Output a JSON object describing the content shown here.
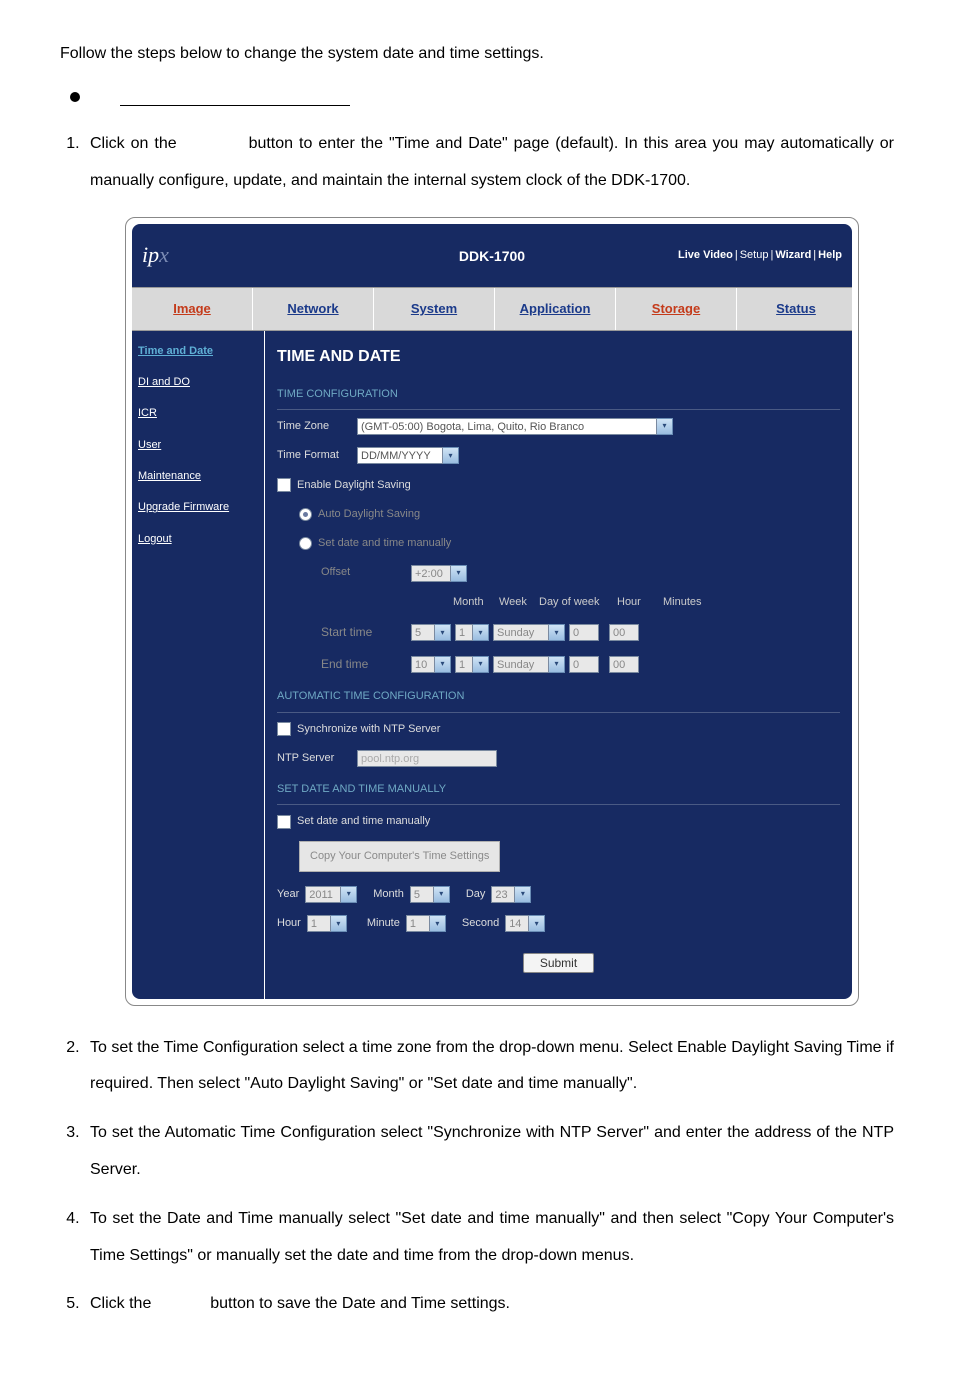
{
  "intro": "Follow the steps below to change the system date and time settings.",
  "steps": {
    "s1a": "Click on the ",
    "s1b": " button to enter the \"Time and Date\" page (default).  In this area you may automatically or manually configure, update, and maintain the internal system clock of the DDK-1700.",
    "s2": "To set the Time Configuration select a time zone from the drop-down menu. Select Enable Daylight Saving Time if required. Then select \"Auto Daylight Saving\" or \"Set date and time manually\".",
    "s3": "To set the Automatic Time Configuration select \"Synchronize with NTP Server\" and enter the address of the NTP Server.",
    "s4": "To set the Date and Time manually select \"Set date and time manually\" and then select \"Copy Your Computer's Time Settings\" or manually set the date and time from the drop-down menus.",
    "s5a": "Click the ",
    "s5b": " button to save the Date and Time settings."
  },
  "ui": {
    "brand1": "ip",
    "brand2": "x",
    "model": "DDK-1700",
    "topLinks": {
      "live": "Live Video",
      "setup": "Setup",
      "wizard": "Wizard",
      "help": "Help"
    },
    "tabs": {
      "image": "Image",
      "network": "Network",
      "system": "System",
      "application": "Application",
      "storage": "Storage",
      "status": "Status"
    },
    "sidebar": {
      "timeAndDate": "Time and Date",
      "diDo": "DI and DO",
      "icr": "ICR",
      "user": "User",
      "maintenance": "Maintenance",
      "upgrade": "Upgrade Firmware",
      "logout": "Logout"
    },
    "content": {
      "title": "TIME AND DATE",
      "sec1": "TIME CONFIGURATION",
      "timeZoneLabel": "Time Zone",
      "timeZoneValue": "(GMT-05:00) Bogota, Lima, Quito, Rio Branco",
      "timeFormatLabel": "Time Format",
      "timeFormatValue": "DD/MM/YYYY",
      "enableDST": "Enable Daylight Saving",
      "autoDST": "Auto Daylight Saving",
      "manualDST": "Set date and time manually",
      "offsetLabel": "Offset",
      "offsetValue": "+2:00",
      "colMonth": "Month",
      "colWeek": "Week",
      "colDow": "Day of week",
      "colHour": "Hour",
      "colMin": "Minutes",
      "startLabel": "Start time",
      "endLabel": "End time",
      "startMonth": "5",
      "startWeek": "1",
      "startDow": "Sunday",
      "startHour": "0",
      "startMin": "00",
      "endMonth": "10",
      "endWeek": "1",
      "endDow": "Sunday",
      "endHour": "0",
      "endMin": "00",
      "sec2": "AUTOMATIC TIME CONFIGURATION",
      "syncNtp": "Synchronize with NTP Server",
      "ntpLabel": "NTP Server",
      "ntpPlaceholder": "pool.ntp.org",
      "sec3": "SET DATE AND TIME MANUALLY",
      "manualChk": "Set date and time manually",
      "copyBtn": "Copy Your Computer's Time Settings",
      "yearL": "Year",
      "yearV": "2011",
      "monthL": "Month",
      "monthV": "5",
      "dayL": "Day",
      "dayV": "23",
      "hourL": "Hour",
      "hourV": "1",
      "minuteL": "Minute",
      "minuteV": "1",
      "secondL": "Second",
      "secondV": "14",
      "submit": "Submit"
    }
  }
}
